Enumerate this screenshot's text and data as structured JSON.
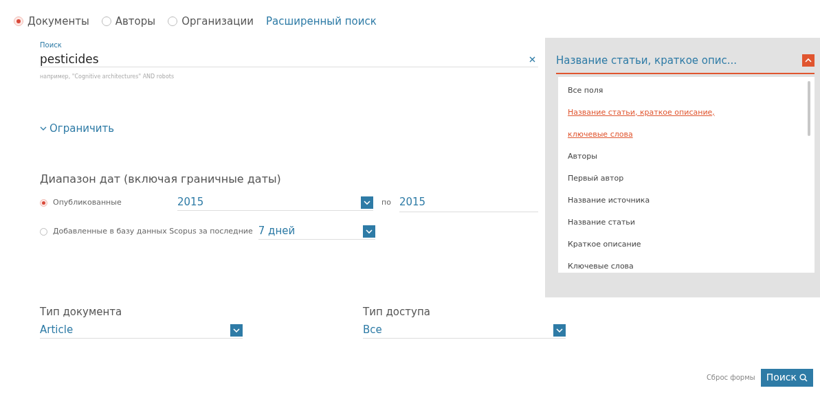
{
  "search_types": [
    {
      "label": "Документы",
      "selected": true
    },
    {
      "label": "Авторы",
      "selected": false
    },
    {
      "label": "Организации",
      "selected": false
    }
  ],
  "advanced_link": "Расширенный поиск",
  "search": {
    "label": "Поиск",
    "value": "pesticides",
    "hint": "например, \"Cognitive architectures\" AND robots"
  },
  "field_select": {
    "value": "Название статьи, краткое опис...",
    "expanded": true,
    "options": [
      {
        "label": "Все поля",
        "selected": false
      },
      {
        "label": "Название статьи, краткое описание, ключевые слова",
        "selected": true
      },
      {
        "label": "Авторы",
        "selected": false
      },
      {
        "label": "Первый автор",
        "selected": false
      },
      {
        "label": "Название источника",
        "selected": false
      },
      {
        "label": "Название статьи",
        "selected": false
      },
      {
        "label": "Краткое описание",
        "selected": false
      },
      {
        "label": "Ключевые слова",
        "selected": false
      }
    ]
  },
  "limit_toggle": {
    "label": "Ограничить",
    "expanded": true
  },
  "date_range": {
    "title": "Диапазон дат (включая граничные даты)",
    "published": {
      "label": "Опубликованные",
      "selected": true,
      "from": "2015",
      "to_label": "по",
      "to": "2015"
    },
    "added": {
      "label": "Добавленные в базу данных Scopus за последние",
      "selected": false,
      "value": "7 дней"
    }
  },
  "document_type": {
    "label": "Тип документа",
    "value": "Article"
  },
  "access_type": {
    "label": "Тип доступа",
    "value": "Все"
  },
  "reset_link": "Сброс формы",
  "search_button": "Поиск"
}
